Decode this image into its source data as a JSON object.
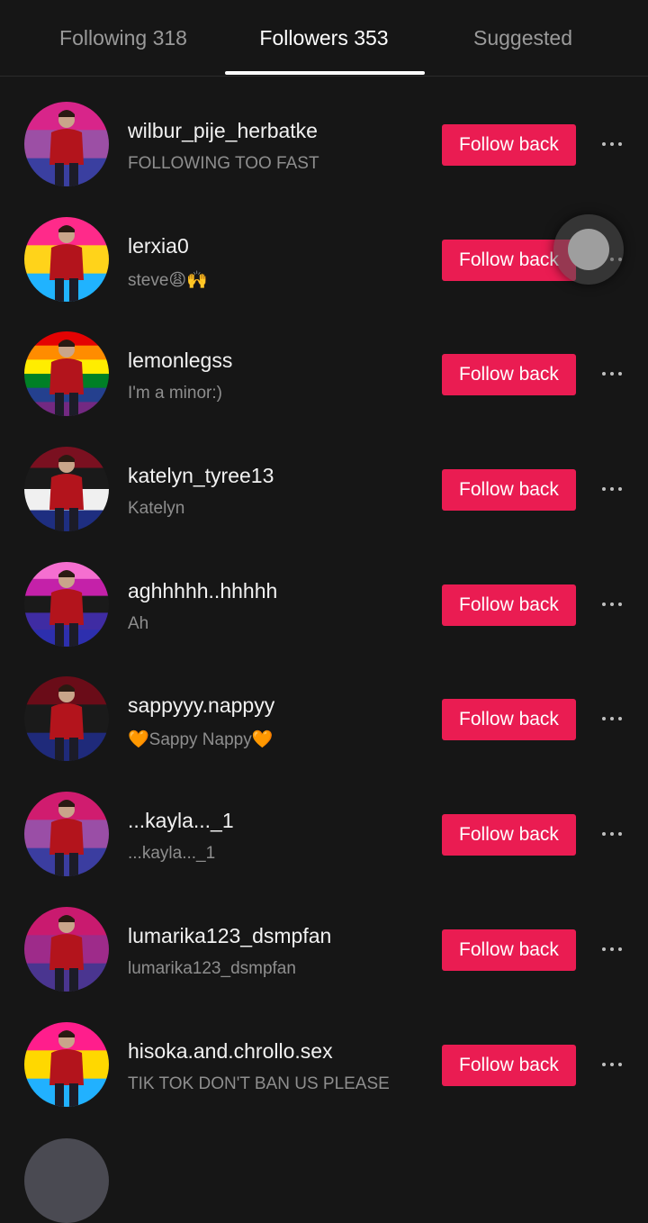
{
  "tabs": [
    {
      "label": "Following 318"
    },
    {
      "label": "Followers 353"
    },
    {
      "label": "Suggested"
    }
  ],
  "active_tab": "Followers 353",
  "follow_back_label": "Follow back",
  "colors": {
    "background": "#161616",
    "follow_button": "#ea1c52",
    "secondary_text": "#8e8e8e"
  },
  "followers": [
    {
      "username": "wilbur_pije_herbatke",
      "bio": "FOLLOWING TOO FAST",
      "avatar_bands": [
        "#d8258a",
        "#9c4fa5",
        "#3a3fa0"
      ]
    },
    {
      "username": "lerxia0",
      "bio": "steve😩🙌",
      "avatar_bands": [
        "#ff2a8a",
        "#ffd31a",
        "#20b3ff"
      ]
    },
    {
      "username": "lemonlegss",
      "bio": "I'm a minor:)",
      "avatar_bands": [
        "#e40303",
        "#ff8c00",
        "#ffed00",
        "#008026",
        "#24408e",
        "#732982"
      ]
    },
    {
      "username": "katelyn_tyree13",
      "bio": "Katelyn",
      "avatar_bands": [
        "#7a1020",
        "#1a1a1a",
        "#f0f0f0",
        "#1e2e80"
      ]
    },
    {
      "username": "aghhhhh..hhhhh",
      "bio": "Ah",
      "avatar_bands": [
        "#f56fd0",
        "#c421a9",
        "#1a1a1a",
        "#3f2ca3",
        "#2d2fae"
      ]
    },
    {
      "username": "sappyyy.nappyy",
      "bio": "🧡Sappy Nappy🧡",
      "avatar_bands": [
        "#6a0c18",
        "#1a1a1a",
        "#1f2a7a"
      ]
    },
    {
      "username": "...kayla..._1",
      "bio": "...kayla..._1",
      "avatar_bands": [
        "#d01c6f",
        "#9a4ea6",
        "#3b3da0"
      ]
    },
    {
      "username": "lumarika123_dsmpfan",
      "bio": "lumarika123_dsmpfan",
      "avatar_bands": [
        "#c91a6f",
        "#9e2b8a",
        "#4a3590"
      ]
    },
    {
      "username": "hisoka.and.chrollo.sex",
      "bio": "TIK TOK DON'T BAN US PLEASE",
      "avatar_bands": [
        "#ff1e8c",
        "#ffd800",
        "#21b1ff"
      ]
    }
  ]
}
